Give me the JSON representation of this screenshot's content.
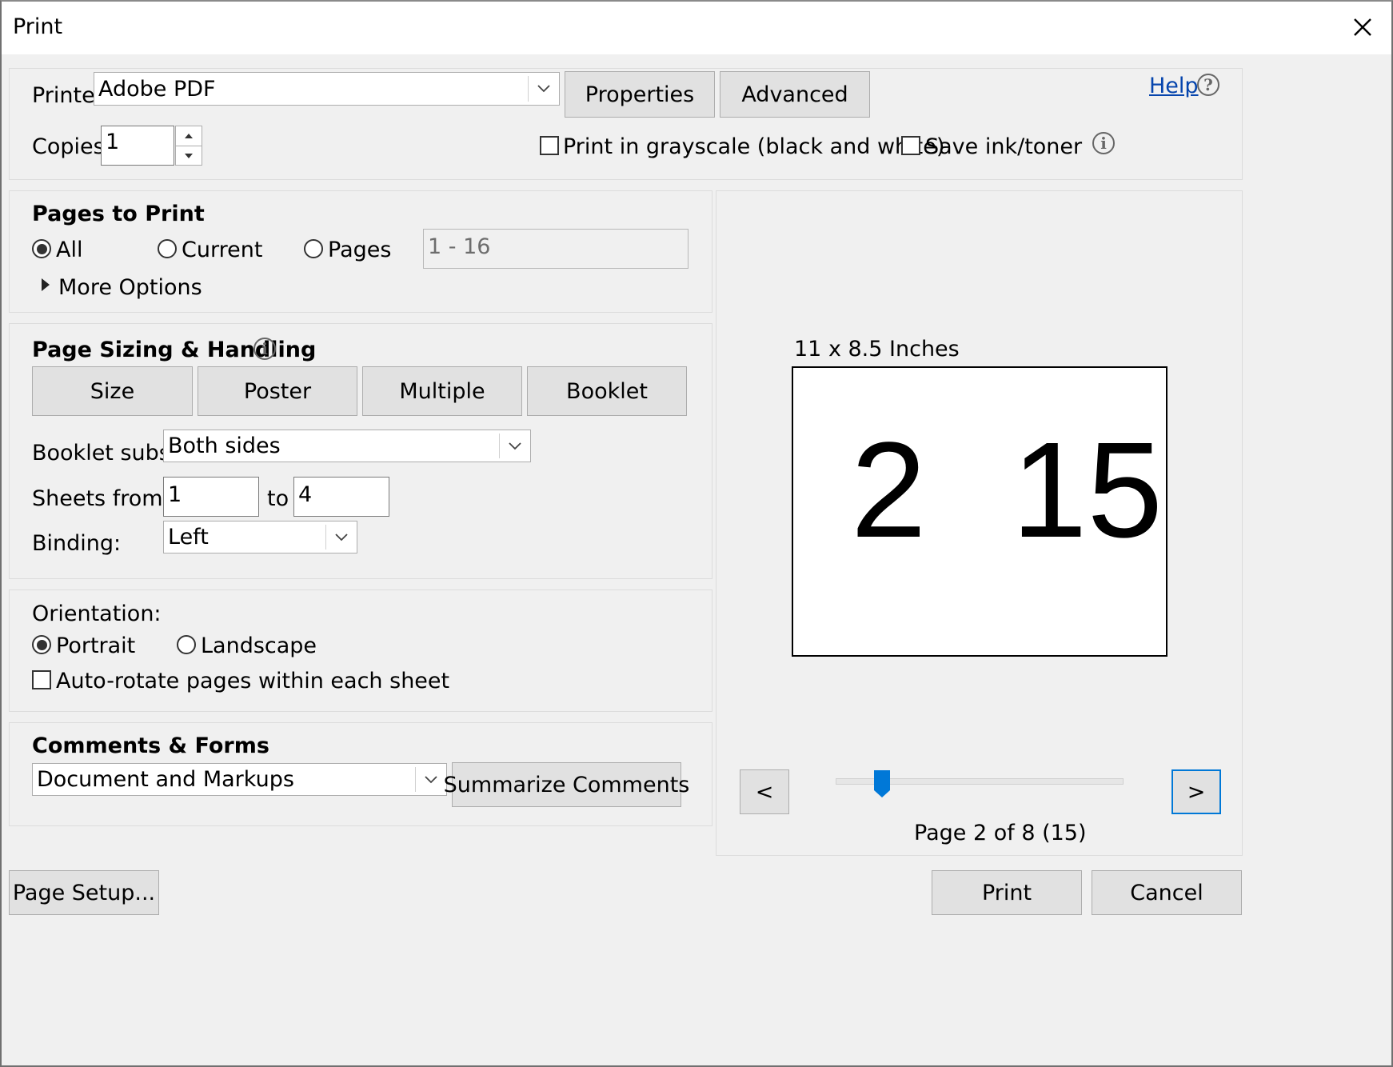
{
  "window": {
    "title": "Print"
  },
  "printer": {
    "label": "Printer:",
    "value": "Adobe PDF",
    "properties_btn": "Properties",
    "advanced_btn": "Advanced",
    "help_link": "Help",
    "copies_label": "Copies:",
    "copies_value": "1",
    "grayscale_label": "Print in grayscale (black and white)",
    "grayscale_checked": false,
    "save_ink_label": "Save ink/toner",
    "save_ink_checked": false
  },
  "pages_to_print": {
    "heading": "Pages to Print",
    "all_label": "All",
    "current_label": "Current",
    "pages_label": "Pages",
    "selected": "All",
    "pages_range": "1 - 16",
    "more_options": "More Options"
  },
  "sizing": {
    "heading": "Page Sizing & Handling",
    "tabs": [
      "Size",
      "Poster",
      "Multiple",
      "Booklet"
    ],
    "booklet_subset_label": "Booklet subset:",
    "booklet_subset_value": "Both sides",
    "sheets_from_label": "Sheets from",
    "sheets_from": "1",
    "to_label": "to",
    "sheets_to": "4",
    "binding_label": "Binding:",
    "binding_value": "Left"
  },
  "orientation": {
    "label": "Orientation:",
    "portrait": "Portrait",
    "landscape": "Landscape",
    "selected": "Portrait",
    "autorotate_label": "Auto-rotate pages within each sheet",
    "autorotate_checked": false
  },
  "comments": {
    "heading": "Comments & Forms",
    "value": "Document and Markups",
    "summarize_btn": "Summarize Comments"
  },
  "preview": {
    "size_label": "11 x 8.5 Inches",
    "left_page": "2",
    "right_page": "15",
    "prev_btn": "<",
    "next_btn": ">",
    "slider_position": 0.16,
    "status": "Page 2 of 8 (15)"
  },
  "footer": {
    "page_setup_btn": "Page Setup...",
    "print_btn": "Print",
    "cancel_btn": "Cancel"
  }
}
